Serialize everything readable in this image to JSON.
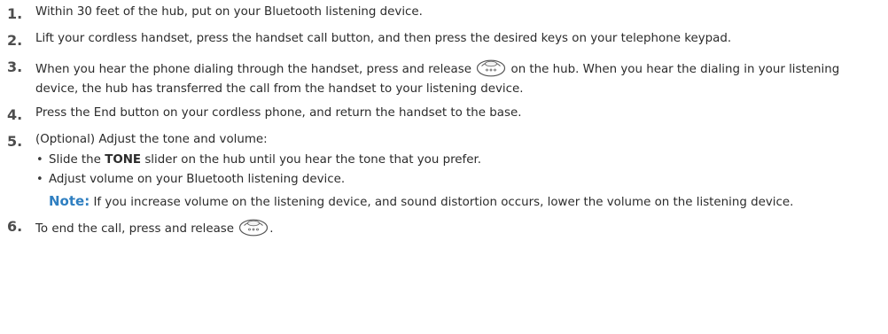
{
  "steps": [
    {
      "number": "1.",
      "text": "Within 30 feet of the hub, put on your Bluetooth listening device."
    },
    {
      "number": "2.",
      "text": "Lift your cordless handset, press the handset call button, and then press the desired keys on your telephone keypad."
    },
    {
      "number": "3.",
      "text_before": "When you hear the phone dialing through the handset, press and release",
      "text_after": "on the hub. When you hear the dialing in your listening device, the hub has transferred the call from the handset to your listening device."
    },
    {
      "number": "4.",
      "text": "Press the End button on your cordless phone, and return the handset to the base."
    },
    {
      "number": "5.",
      "text": "(Optional) Adjust the tone and volume:",
      "sub_items": [
        {
          "before": "Slide the",
          "bold": "TONE",
          "after": "slider on the hub until you hear the tone that you prefer."
        },
        {
          "text": "Adjust volume on your Bluetooth listening device."
        }
      ],
      "note": {
        "label": "Note:",
        "text": "If you increase volume on the listening device, and sound distortion occurs, lower the volume on the listening device."
      }
    },
    {
      "number": "6.",
      "text_before": "To end the call, press and release",
      "text_after": "."
    }
  ],
  "icons": {
    "hub_button": "hub-call-button-icon",
    "bullet": "•"
  },
  "colors": {
    "text": "#2b2b2b",
    "number": "#4d4d4d",
    "note_label": "#2f7fc1"
  }
}
